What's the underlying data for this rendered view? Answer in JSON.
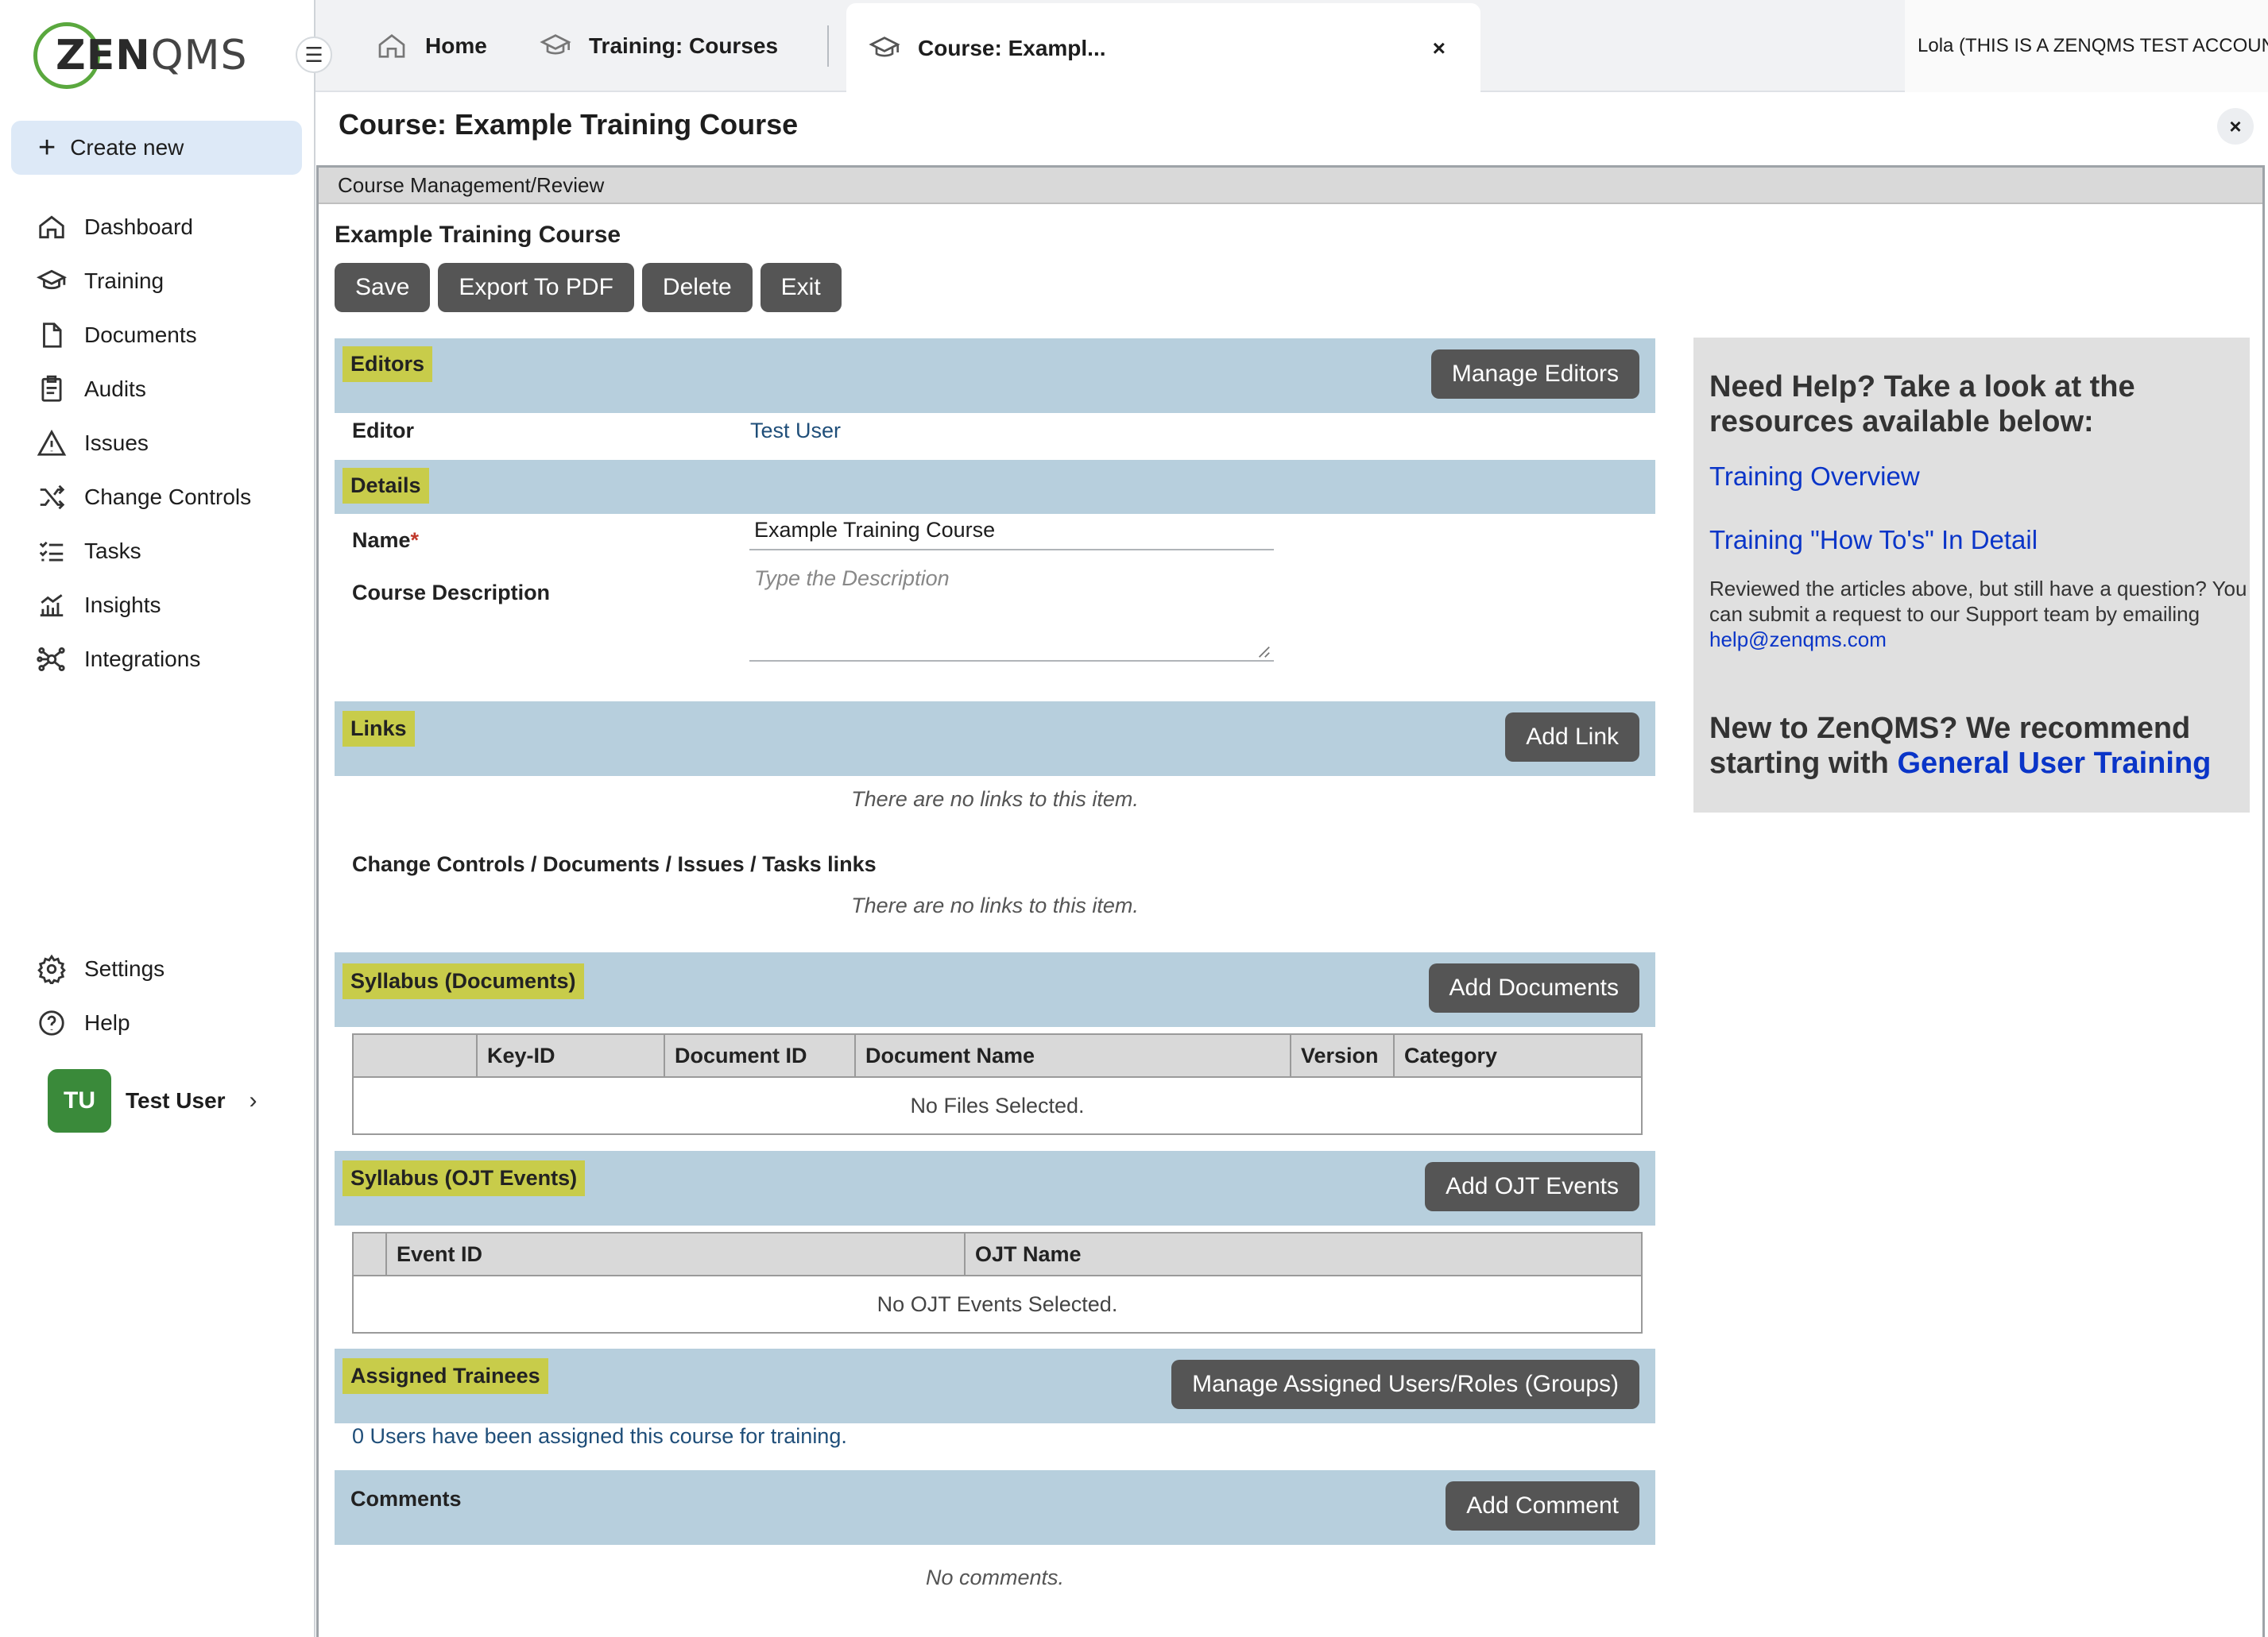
{
  "brand": {
    "logo_zen": "ZEN",
    "logo_qms": "QMS"
  },
  "sidebar": {
    "create_new": "Create new",
    "items": [
      {
        "label": "Dashboard",
        "icon": "home-icon"
      },
      {
        "label": "Training",
        "icon": "graduation-cap-icon"
      },
      {
        "label": "Documents",
        "icon": "document-icon"
      },
      {
        "label": "Audits",
        "icon": "clipboard-icon"
      },
      {
        "label": "Issues",
        "icon": "warning-icon"
      },
      {
        "label": "Change Controls",
        "icon": "shuffle-icon"
      },
      {
        "label": "Tasks",
        "icon": "checklist-icon"
      },
      {
        "label": "Insights",
        "icon": "chart-icon"
      },
      {
        "label": "Integrations",
        "icon": "network-icon"
      }
    ],
    "bottom_items": [
      {
        "label": "Settings",
        "icon": "gear-icon"
      },
      {
        "label": "Help",
        "icon": "help-circle-icon"
      }
    ],
    "user": {
      "initials": "TU",
      "name": "Test User"
    }
  },
  "tabs": {
    "home": "Home",
    "training_courses": "Training: Courses",
    "active": "Course: Exampl...",
    "close_glyph": "×"
  },
  "account": {
    "label": "Lola (THIS IS A ZENQMS TEST ACCOUNT"
  },
  "page": {
    "title": "Course: Example Training Course",
    "close_glyph": "×",
    "frame_header": "Course Management/Review",
    "course_name": "Example Training Course"
  },
  "actions": {
    "save": "Save",
    "export": "Export To PDF",
    "delete": "Delete",
    "exit": "Exit"
  },
  "editors": {
    "heading": "Editors",
    "button": "Manage Editors",
    "label": "Editor",
    "value": "Test User"
  },
  "details": {
    "heading": "Details",
    "name_label": "Name",
    "required_mark": "*",
    "name_value": "Example Training Course",
    "desc_label": "Course Description",
    "desc_placeholder": "Type the Description"
  },
  "links": {
    "heading": "Links",
    "button": "Add Link",
    "empty": "There are no links to this item.",
    "sub_label": "Change Controls / Documents / Issues / Tasks links",
    "sub_empty": "There are no links to this item."
  },
  "syllabus_docs": {
    "heading": "Syllabus (Documents)",
    "button": "Add Documents",
    "columns": [
      "",
      "Key-ID",
      "Document ID",
      "Document Name",
      "Version",
      "Category"
    ],
    "empty": "No Files Selected."
  },
  "syllabus_ojt": {
    "heading": "Syllabus (OJT Events)",
    "button": "Add OJT Events",
    "columns": [
      "",
      "Event ID",
      "OJT Name"
    ],
    "empty": "No OJT Events Selected."
  },
  "trainees": {
    "heading": "Assigned Trainees",
    "button": "Manage Assigned Users/Roles (Groups)",
    "text": "0 Users have been assigned this course for training."
  },
  "comments": {
    "heading": "Comments",
    "button": "Add Comment",
    "empty": "No comments."
  },
  "help": {
    "heading": "Need Help? Take a look at the resources available below:",
    "link1": "Training Overview",
    "link2": "Training \"How To's\" In Detail",
    "body": "Reviewed the articles above, but still have a question? You can submit a request to our Support team by emailing",
    "email": "help@zenqms.com",
    "rec_prefix": "New to ZenQMS? We recommend starting with",
    "rec_link": "General User Training"
  }
}
